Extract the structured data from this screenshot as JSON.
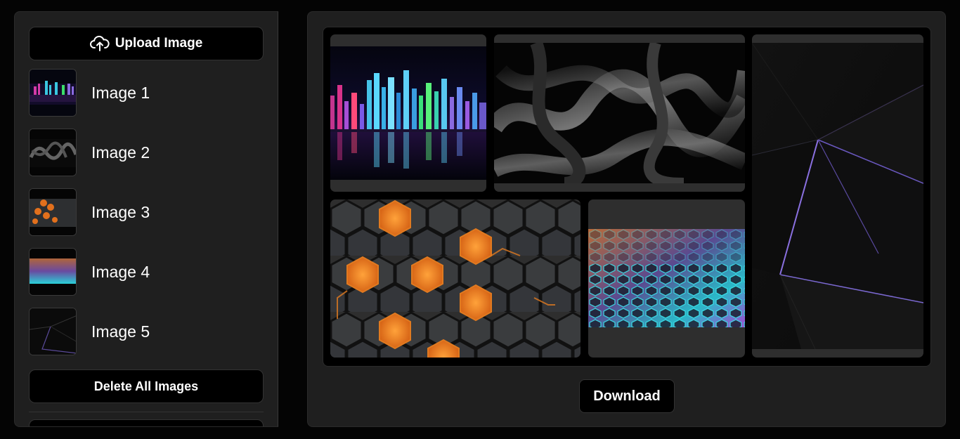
{
  "sidebar": {
    "upload_label": "Upload Image",
    "delete_label": "Delete All Images",
    "images": [
      {
        "label": "Image 1",
        "icon": "city-thumbnail"
      },
      {
        "label": "Image 2",
        "icon": "abstract-waves-thumbnail"
      },
      {
        "label": "Image 3",
        "icon": "orange-hex-thumbnail"
      },
      {
        "label": "Image 4",
        "icon": "neon-hex-thumbnail"
      },
      {
        "label": "Image 5",
        "icon": "dark-polygon-thumbnail"
      }
    ]
  },
  "main": {
    "download_label": "Download"
  },
  "colors": {
    "background": "#040404",
    "panel": "#1f1f1f",
    "button": "#000000",
    "cell": "#2e2e2e"
  }
}
